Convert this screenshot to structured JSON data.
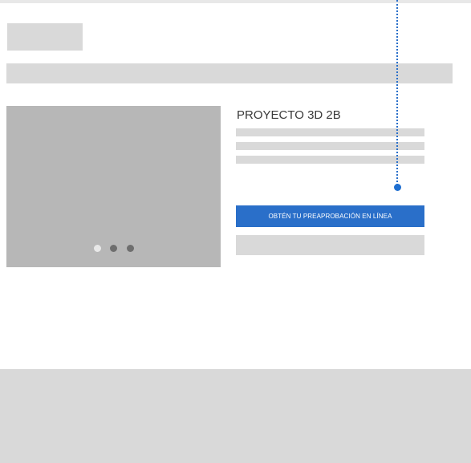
{
  "project": {
    "title": "PROYECTO 3D 2B"
  },
  "cta": {
    "label": "OBTÉN TU PREAPROBACIÓN EN LÍNEA"
  },
  "carousel": {
    "slide_count": 3,
    "active_index": 0
  },
  "colors": {
    "accent": "#2a6fc9",
    "button_text": "#ffffff",
    "dot_active": "#e8e8e8",
    "dot_inactive": "#6e6e6e",
    "annotation_marker": "#1f6fd1"
  }
}
